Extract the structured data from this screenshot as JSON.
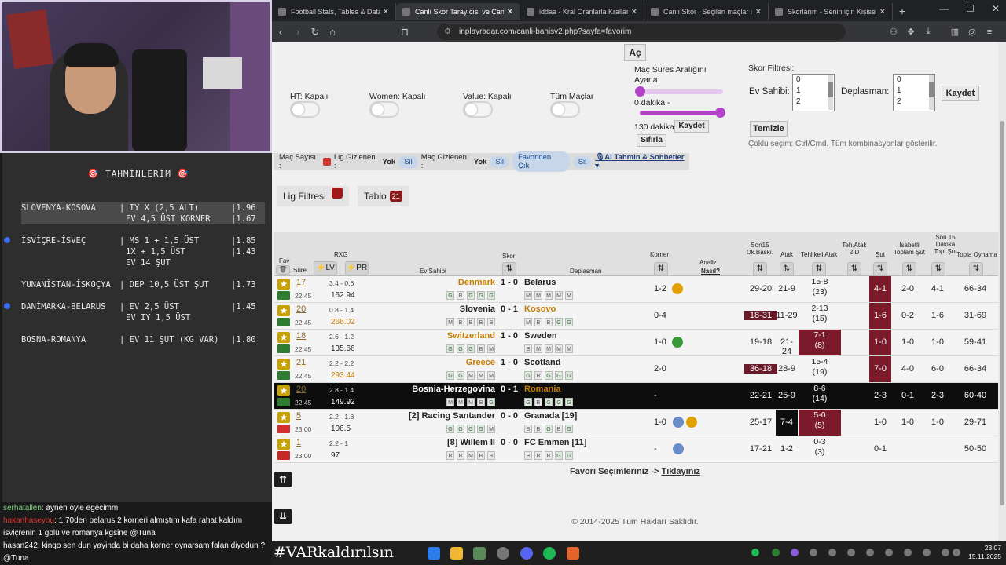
{
  "predictions": {
    "title": "🎯 TAHMİNLERİM 🎯",
    "rows": [
      {
        "match": "SLOVENYA-KOSOVA",
        "lines": [
          {
            "bet": "| IY X (2,5 ALT)",
            "odd": "|1.96"
          },
          {
            "bet": "EV 4,5 ÜST KORNER",
            "odd": "|1.67"
          }
        ],
        "dot": false,
        "highlight": true
      },
      {
        "match": "İSVİÇRE-İSVEÇ",
        "lines": [
          {
            "bet": "| MS 1 + 1,5 ÜST",
            "odd": "|1.85"
          },
          {
            "bet": "1X + 1,5 ÜST",
            "odd": "|1.43"
          },
          {
            "bet": "EV 14 ŞUT",
            "odd": ""
          }
        ],
        "dot": true,
        "highlight": false
      },
      {
        "match": "YUNANİSTAN-İSKOÇYA",
        "lines": [
          {
            "bet": "| DEP 10,5 ÜST ŞUT",
            "odd": "|1.73"
          }
        ],
        "dot": false,
        "highlight": false
      },
      {
        "match": "DANİMARKA-BELARUS",
        "lines": [
          {
            "bet": "| EV 2,5 ÜST",
            "odd": "|1.45"
          },
          {
            "bet": "EV IY 1,5 ÜST",
            "odd": ""
          }
        ],
        "dot": true,
        "highlight": false
      },
      {
        "match": "BOSNA-ROMANYA",
        "lines": [
          {
            "bet": "| EV 11 ŞUT (KG VAR)",
            "odd": "|1.80"
          }
        ],
        "dot": false,
        "highlight": false
      }
    ]
  },
  "chat": [
    {
      "user": "serhatallen",
      "text": ": aynen öyle egecimm",
      "cls": "u1"
    },
    {
      "user": "hakanhaseyou",
      "text": ": 1.70den belarus 2 korneri almıştım kafa rahat kaldım",
      "cls": "u2"
    },
    {
      "user": "",
      "text": "isviçrenin 1 golü ve romanya kgsine @Tuna",
      "cls": "u3"
    },
    {
      "user": "hasan242",
      "text": ": kingo sen dun yayinda bi daha korner oynarsam falan diyodun ?",
      "cls": "u3"
    },
    {
      "user": "",
      "text": "@Tuna",
      "cls": "u3"
    }
  ],
  "browser": {
    "tabs": [
      {
        "label": "Football Stats, Tables & Data | Socc",
        "active": false
      },
      {
        "label": "Canlı Skor Tarayıcısı ve Canlı Sk",
        "active": true
      },
      {
        "label": "iddaa - Kral Oranlarla Krallar Gibi K",
        "active": false
      },
      {
        "label": "Canlı Skor | Seçilen maçlar için canl",
        "active": false
      },
      {
        "label": "Skorlarım - Senin için Kişiselleştiril",
        "active": false
      }
    ],
    "url": "inplayradar.com/canli-bahisv2.php?sayfa=favorim"
  },
  "filters": {
    "ac_label": "Aç",
    "ht": "HT: Kapalı",
    "women": "Women: Kapalı",
    "value": "Value: Kapalı",
    "all": "Tüm Maçlar",
    "range_title": "Maç Süres Aralığını Ayarla:",
    "range_min": "0 dakika -",
    "range_max": "130 dakika",
    "kaydet": "Kaydet",
    "sifirla": "Sıfırla",
    "score_title": "Skor Filtresi:",
    "home_label": "Ev Sahibi:",
    "away_label": "Deplasman:",
    "options": [
      "0",
      "1",
      "2"
    ],
    "save2": "Kaydet",
    "clear": "Temizle",
    "hint": "Çoklu seçim: Ctrl/Cmd. Tüm kombinasyonlar gösterilir."
  },
  "actionbar": {
    "mac_sayisi": "Maç Sayısı :",
    "lig_gizlenen": "Lig Gizlenen :",
    "yok": "Yok",
    "sil": "Sil",
    "mac_gizlenen": "Maç Gizlenen :",
    "favoriden_cik": "Favoriden Çık",
    "ai": "🎙AI Tahmin & Sohbetler ▾"
  },
  "lig_filtresi": "Lig Filtresi",
  "tablo": "Tablo",
  "tablo_count": "21",
  "headers": {
    "fav": "Fav",
    "sure": "Süre",
    "rxg": "RXG",
    "lv": "⚡LV",
    "pr": "⚡PR",
    "ev": "Ev Sahibi",
    "skor": "Skor",
    "dep": "Deplasman",
    "korner": "Korner",
    "analiz": "Analiz",
    "nasil": "Nasıl?",
    "son15": "Son15 Dk.Baskı.",
    "atak": "Atak",
    "tehlikeli": "Tehlikeli Atak",
    "tehatak": "Teh.Atak 2.D",
    "sut": "Şut",
    "isabetli": "İsabetli Toplam Şut",
    "son15sut": "Son 15 Dakika Topl.Şut",
    "topla": "Topla Oynama"
  },
  "matches": [
    {
      "min": "17",
      "time": "22:45",
      "rxg": "3.4 - 0.6",
      "rxg2": "162.94",
      "home": "Denmark",
      "away": "Belarus",
      "score": "1 - 0",
      "hb": [
        "G",
        "B",
        "G",
        "G",
        "G"
      ],
      "ab": [
        "M",
        "M",
        "M",
        "M",
        "M"
      ],
      "korner": "1-2",
      "son15": "29-20",
      "atak": "21-9",
      "teh": "15-8",
      "teh2": "(23)",
      "sut": "4-1",
      "isb": "2-0",
      "s15": "4-1",
      "topla": "66-34",
      "dark": false,
      "homeHl": true,
      "awayHl": false,
      "flag": "#2e7d32"
    },
    {
      "min": "20",
      "time": "22:45",
      "rxg": "0.8 - 1.4",
      "rxg2": "266.02",
      "home": "Slovenia",
      "away": "Kosovo",
      "score": "0 - 1",
      "hb": [
        "M",
        "B",
        "B",
        "B",
        "B"
      ],
      "ab": [
        "M",
        "B",
        "B",
        "G",
        "G"
      ],
      "korner": "0-4",
      "son15": "18-31",
      "atak": "11-29",
      "teh": "2-13",
      "teh2": "(15)",
      "sut": "1-6",
      "isb": "0-2",
      "s15": "1-6",
      "topla": "31-69",
      "dark": false,
      "homeHl": false,
      "awayHl": true,
      "flag": "#2e7d32"
    },
    {
      "min": "18",
      "time": "22:45",
      "rxg": "2.6 - 1.2",
      "rxg2": "135.66",
      "home": "Switzerland",
      "away": "Sweden",
      "score": "1 - 0",
      "hb": [
        "G",
        "G",
        "G",
        "B",
        "M"
      ],
      "ab": [
        "B",
        "M",
        "M",
        "M",
        "M"
      ],
      "korner": "1-0",
      "son15": "19-18",
      "atak": "21-24",
      "teh": "7-1",
      "teh2": "(8)",
      "sut": "1-0",
      "isb": "1-0",
      "s15": "1-0",
      "topla": "59-41",
      "dark": false,
      "homeHl": true,
      "awayHl": false,
      "flag": "#2e7d32"
    },
    {
      "min": "21",
      "time": "22:45",
      "rxg": "2.2 - 2.2",
      "rxg2": "293.44",
      "home": "Greece",
      "away": "Scotland",
      "score": "1 - 0",
      "hb": [
        "G",
        "G",
        "M",
        "M",
        "M"
      ],
      "ab": [
        "G",
        "B",
        "G",
        "G",
        "G"
      ],
      "korner": "2-0",
      "son15": "36-18",
      "atak": "28-9",
      "teh": "15-4",
      "teh2": "(19)",
      "sut": "7-0",
      "isb": "4-0",
      "s15": "6-0",
      "topla": "66-34",
      "dark": false,
      "homeHl": true,
      "awayHl": false,
      "flag": "#2e7d32"
    },
    {
      "min": "20",
      "time": "22:45",
      "rxg": "2.8 - 1.4",
      "rxg2": "149.92",
      "home": "Bosnia-Herzegovina",
      "away": "Romania",
      "score": "0 - 1",
      "hb": [
        "M",
        "M",
        "M",
        "B",
        "G"
      ],
      "ab": [
        "G",
        "B",
        "G",
        "G",
        "G"
      ],
      "korner": "-",
      "son15": "22-21",
      "atak": "25-9",
      "teh": "8-6",
      "teh2": "(14)",
      "sut": "2-3",
      "isb": "0-1",
      "s15": "2-3",
      "topla": "60-40",
      "dark": true,
      "homeHl": false,
      "awayHl": true,
      "flag": "#2e7d32"
    },
    {
      "min": "5",
      "time": "23:00",
      "rxg": "2.2 - 1.8",
      "rxg2": "106.5",
      "home": "[2] Racing Santander",
      "away": "Granada [19]",
      "score": "0 - 0",
      "hb": [
        "G",
        "G",
        "G",
        "G",
        "M"
      ],
      "ab": [
        "B",
        "B",
        "G",
        "B",
        "G"
      ],
      "korner": "1-0",
      "son15": "25-17",
      "atak": "7-4",
      "teh": "5-0",
      "teh2": "(5)",
      "sut": "1-0",
      "isb": "1-0",
      "s15": "1-0",
      "topla": "29-71",
      "dark": false,
      "homeHl": false,
      "awayHl": false,
      "flag": "#d32f2f"
    },
    {
      "min": "1",
      "time": "23:00",
      "rxg": "2.2 - 1",
      "rxg2": "97",
      "home": "[8] Willem II",
      "away": "FC Emmen [11]",
      "score": "0 - 0",
      "hb": [
        "B",
        "B",
        "M",
        "B",
        "B"
      ],
      "ab": [
        "B",
        "B",
        "B",
        "G",
        "G"
      ],
      "korner": "-",
      "son15": "17-21",
      "atak": "1-2",
      "teh": "0-3",
      "teh2": "(3)",
      "sut": "0-1",
      "isb": "",
      "s15": "",
      "topla": "50-50",
      "dark": false,
      "homeHl": false,
      "awayHl": false,
      "flag": "#c62828"
    }
  ],
  "fav_text": "Favori Seçimleriniz -> ",
  "fav_link": "Tıklayınız",
  "copyright": "© 2014-2025 Tüm Hakları Saklıdır.",
  "hashtag": "#VARkaldırılsın",
  "clock": {
    "time": "23:07",
    "date": "15.11.2025"
  }
}
